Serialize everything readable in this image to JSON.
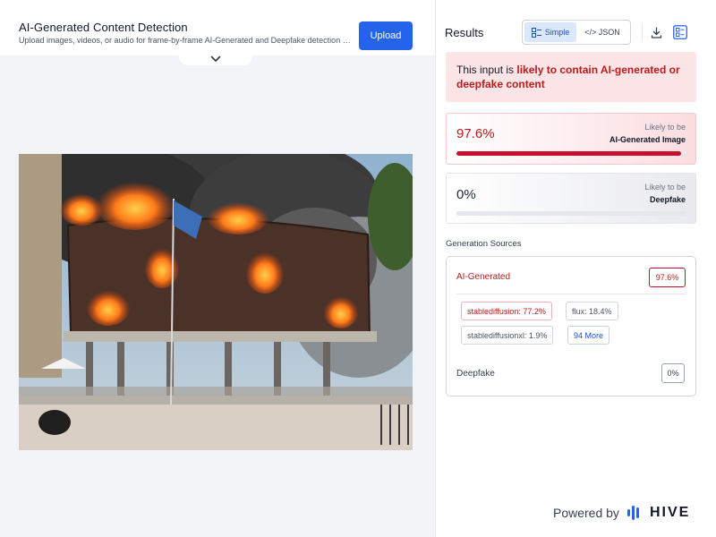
{
  "header": {
    "title": "AI-Generated Content Detection",
    "subtitle": "Upload images, videos, or audio for frame-by-frame AI-Generated and Deepfake detection with...",
    "upload_label": "Upload"
  },
  "results": {
    "title": "Results",
    "toggle": {
      "simple_label": "Simple",
      "json_label": "</> JSON",
      "selected": "Simple"
    },
    "alert": {
      "prefix": "This input is ",
      "highlight": "likely to contain AI-generated or deepfake content"
    },
    "ai_card": {
      "percent": "97.6%",
      "value": 0.976,
      "likely_label": "Likely to be",
      "category": "AI-Generated Image"
    },
    "deepfake_card": {
      "percent": "0%",
      "value": 0.0,
      "likely_label": "Likely to be",
      "category": "Deepfake"
    }
  },
  "generation_sources": {
    "title": "Generation Sources",
    "ai_label": "AI-Generated",
    "ai_percent": "97.6%",
    "chips": [
      {
        "label": "stablediffusion: 77.2%"
      },
      {
        "label": "flux: 18.4%"
      },
      {
        "label": "stablediffusionxl: 1.9%"
      },
      {
        "label": "94 More"
      }
    ],
    "deepfake_label": "Deepfake",
    "deepfake_percent": "0%"
  },
  "footer": {
    "powered_by": "Powered by",
    "brand": "HIVE"
  },
  "colors": {
    "accent_blue": "#2563eb",
    "alert_red": "#b91c1c",
    "bar_red": "#c8102e",
    "alert_bg": "#fde4e6"
  },
  "icons": [
    "chevron-down-icon",
    "simple-view-icon",
    "download-icon",
    "layout-toggle-icon",
    "hive-logo-icon"
  ]
}
